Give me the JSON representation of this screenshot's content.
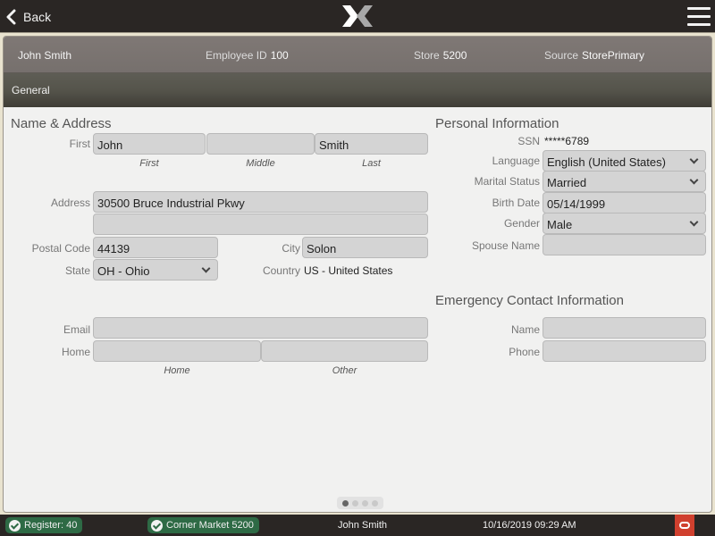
{
  "topbar": {
    "back_label": "Back",
    "logo": "x-logo-icon",
    "menu": "hamburger-menu-icon"
  },
  "header": {
    "employee_name": "John Smith",
    "employee_id_label": "Employee ID",
    "employee_id": "100",
    "store_label": "Store",
    "store": "5200",
    "source_label": "Source",
    "source": "StorePrimary"
  },
  "section": {
    "title": "General"
  },
  "name_address": {
    "title": "Name & Address",
    "first_label": "First",
    "first_value": "John",
    "middle_value": "",
    "last_value": "Smith",
    "sub_first": "First",
    "sub_middle": "Middle",
    "sub_last": "Last",
    "address_label": "Address",
    "address_line1": "30500 Bruce Industrial Pkwy",
    "address_line2": "",
    "postal_label": "Postal Code",
    "postal_value": "44139",
    "city_label": "City",
    "city_value": "Solon",
    "state_label": "State",
    "state_value": "OH - Ohio",
    "country_label": "Country",
    "country_value": "US - United States",
    "email_label": "Email",
    "email_value": "",
    "home_label": "Home",
    "home_value": "",
    "other_value": "",
    "sub_home": "Home",
    "sub_other": "Other"
  },
  "personal": {
    "title": "Personal Information",
    "ssn_label": "SSN",
    "ssn_value": "*****6789",
    "language_label": "Language",
    "language_value": "English (United States)",
    "marital_label": "Marital Status",
    "marital_value": "Married",
    "birth_label": "Birth Date",
    "birth_value": "05/14/1999",
    "gender_label": "Gender",
    "gender_value": "Male",
    "spouse_label": "Spouse Name",
    "spouse_value": ""
  },
  "emergency": {
    "title": "Emergency Contact Information",
    "name_label": "Name",
    "name_value": "",
    "phone_label": "Phone",
    "phone_value": ""
  },
  "pagination": {
    "pages": 4,
    "current": 1
  },
  "statusbar": {
    "register": "Register: 40",
    "store": "Corner Market 5200",
    "user": "John Smith",
    "datetime": "10/16/2019 09:29 AM",
    "status_color": "#2e6a45",
    "oracle_color": "#d0402e"
  }
}
